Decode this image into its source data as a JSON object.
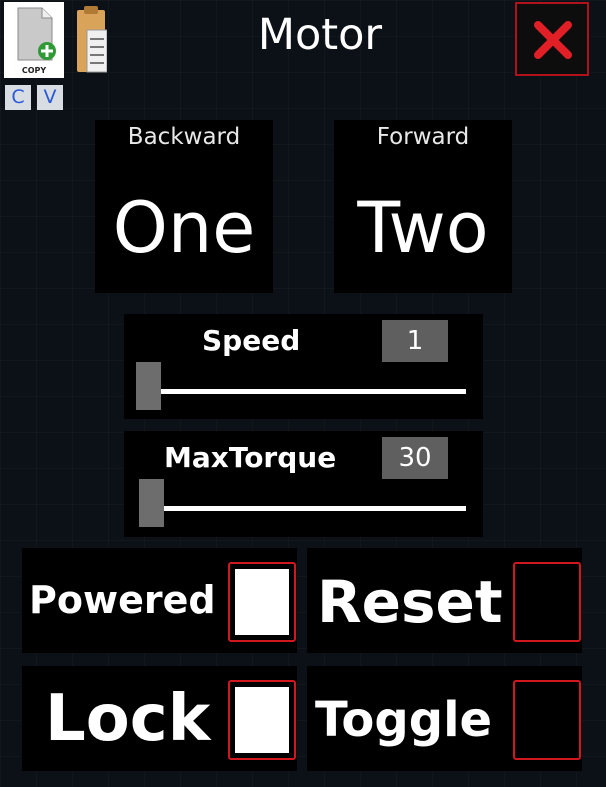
{
  "toolbar": {
    "copy_icon_text": "COPY",
    "key_copy": "C",
    "key_paste": "V"
  },
  "window": {
    "title": "Motor"
  },
  "direction": {
    "backward": {
      "label": "Backward",
      "value": "One"
    },
    "forward": {
      "label": "Forward",
      "value": "Two"
    }
  },
  "sliders": {
    "speed": {
      "label": "Speed",
      "value": "1",
      "level": 0.0
    },
    "max_torque": {
      "label": "MaxTorque",
      "value": "30",
      "level": 0.0
    }
  },
  "toggles": {
    "powered": {
      "label": "Powered",
      "checked": true
    },
    "reset": {
      "label": "Reset",
      "checked": false
    },
    "lock": {
      "label": "Lock",
      "checked": true
    },
    "toggle": {
      "label": "Toggle",
      "checked": false
    }
  },
  "colors": {
    "background": "#0b1116",
    "panel": "#000000",
    "accent_red": "#d2171f",
    "checked_fill": "#ffffff",
    "value_box": "#5f5f5f"
  },
  "icons": [
    "copy-icon",
    "paste-icon",
    "close-icon"
  ]
}
